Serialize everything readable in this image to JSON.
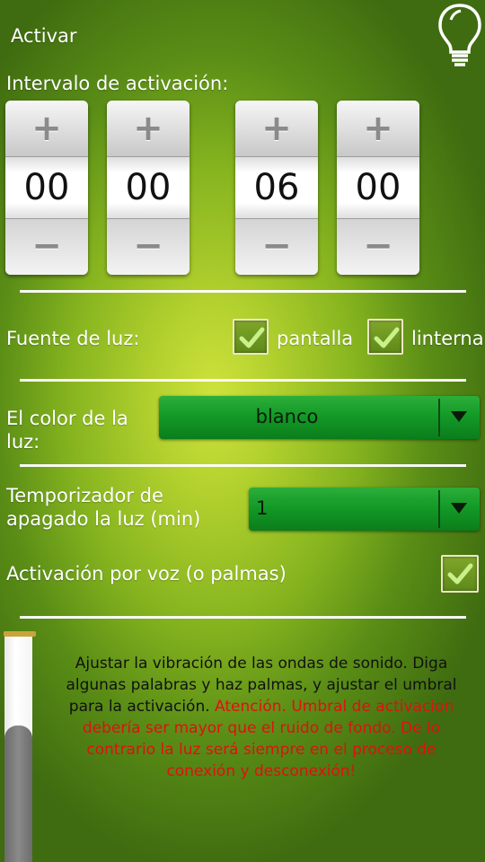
{
  "header": {
    "title": "Activar",
    "icon": "lightbulb-icon"
  },
  "interval": {
    "label": "Intervalo de activación:",
    "plus_glyph": "+",
    "minus_glyph": "−",
    "spinners": [
      {
        "value": "00"
      },
      {
        "value": "00"
      },
      {
        "value": "06"
      },
      {
        "value": "00"
      }
    ]
  },
  "light_source": {
    "label": "Fuente de luz:",
    "options": [
      {
        "label": "pantalla",
        "checked": true
      },
      {
        "label": "linterna",
        "checked": true
      }
    ]
  },
  "color": {
    "label": "El color de la luz:",
    "selected": "blanco"
  },
  "timer": {
    "label": "Temporizador de apagado la luz (min)",
    "selected": "1"
  },
  "voice": {
    "label": "Activación por voz (o palmas)",
    "checked": true
  },
  "sensitivity": {
    "instructions": "Ajustar la vibración de las ondas de sonido. Diga algunas palabras y haz palmas, y ajustar el umbral para la activación.",
    "warning": "Atención. Umbral de activacion debería ser mayor que el ruido de fondo. De lo contrario la luz será siempre en el proceso de conexión y desconexión!"
  },
  "colors": {
    "accent_green": "#149a27",
    "warning_red": "#e11010",
    "text_white": "#ffffff"
  }
}
